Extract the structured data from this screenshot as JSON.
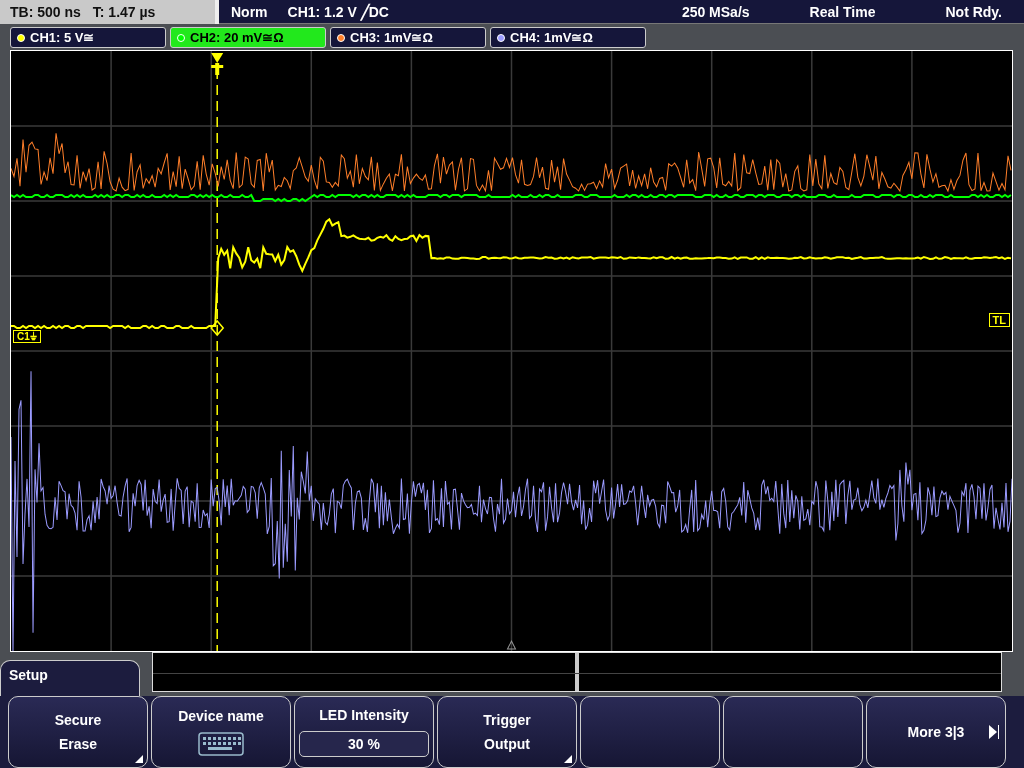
{
  "status_bar": {
    "timebase": "TB: 500 ns",
    "trigger_time": "T: 1.47 µs",
    "mode": "Norm",
    "trigger": "CH1: 1.2 V ╱DC",
    "sample_rate": "250 MSa/s",
    "acquisition": "Real Time",
    "state": "Not Rdy."
  },
  "channels": [
    {
      "label": "CH1: 5 V≅",
      "color": "#ffff00",
      "selected": false
    },
    {
      "label": "CH2: 20 mV≅Ω",
      "color": "#00ff00",
      "selected": true
    },
    {
      "label": "CH3: 1mV≅Ω",
      "color": "#ff7f2a",
      "selected": false
    },
    {
      "label": "CH4: 1mV≅Ω",
      "color": "#9b9bff",
      "selected": false
    }
  ],
  "markers": {
    "channel_label": "C1⏚",
    "trigger_level": "TL"
  },
  "menu": {
    "title": "Setup",
    "softkeys": [
      {
        "kind": "submenu",
        "lines": [
          "Secure",
          "Erase"
        ]
      },
      {
        "kind": "keyboard",
        "lines": [
          "Device name"
        ]
      },
      {
        "kind": "value",
        "lines": [
          "LED Intensity"
        ],
        "value": "30 %"
      },
      {
        "kind": "submenu",
        "lines": [
          "Trigger",
          "Output"
        ]
      },
      {
        "kind": "empty"
      },
      {
        "kind": "empty"
      },
      {
        "kind": "more",
        "lines": [
          "More 3|3"
        ]
      }
    ]
  }
}
